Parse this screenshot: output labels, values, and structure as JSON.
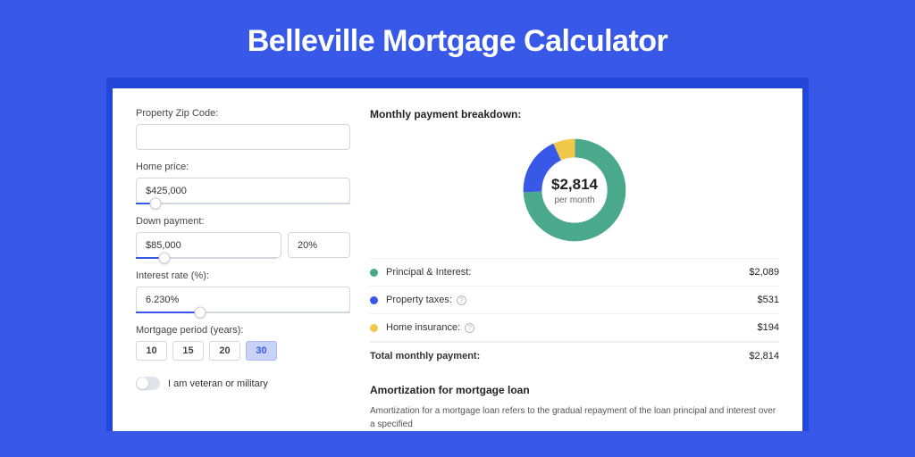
{
  "title": "Belleville Mortgage Calculator",
  "form": {
    "zip": {
      "label": "Property Zip Code:",
      "value": ""
    },
    "home_price": {
      "label": "Home price:",
      "value": "$425,000",
      "slider_pct": 9
    },
    "down_payment": {
      "label": "Down payment:",
      "value": "$85,000",
      "percent": "20%",
      "slider_pct": 20
    },
    "interest_rate": {
      "label": "Interest rate (%):",
      "value": "6.230%",
      "slider_pct": 30
    },
    "period": {
      "label": "Mortgage period (years):",
      "options": [
        "10",
        "15",
        "20",
        "30"
      ],
      "active": 3
    },
    "veteran": {
      "label": "I am veteran or military",
      "on": false
    }
  },
  "breakdown": {
    "title": "Monthly payment breakdown:",
    "center_amount": "$2,814",
    "center_sub": "per month",
    "rows": [
      {
        "label": "Principal & Interest:",
        "value": "$2,089",
        "color": "#4aa98a",
        "info": false
      },
      {
        "label": "Property taxes:",
        "value": "$531",
        "color": "#3859e8",
        "info": true
      },
      {
        "label": "Home insurance:",
        "value": "$194",
        "color": "#f1c94a",
        "info": true
      }
    ],
    "total": {
      "label": "Total monthly payment:",
      "value": "$2,814"
    }
  },
  "chart_data": {
    "type": "pie",
    "title": "Monthly payment breakdown",
    "series": [
      {
        "name": "Principal & Interest",
        "value": 2089,
        "color": "#4aa98a"
      },
      {
        "name": "Property taxes",
        "value": 531,
        "color": "#3859e8"
      },
      {
        "name": "Home insurance",
        "value": 194,
        "color": "#f1c94a"
      }
    ],
    "total": 2814,
    "center_label": "$2,814 per month"
  },
  "amortization": {
    "title": "Amortization for mortgage loan",
    "text": "Amortization for a mortgage loan refers to the gradual repayment of the loan principal and interest over a specified"
  }
}
